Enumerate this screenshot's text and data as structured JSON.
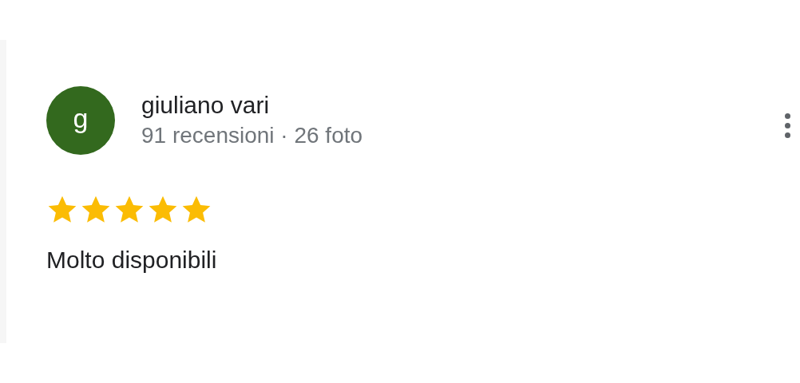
{
  "review": {
    "avatar_letter": "g",
    "author": "giuliano vari",
    "stats": "91 recensioni · 26 foto",
    "stars": 5,
    "text": "Molto disponibili"
  }
}
